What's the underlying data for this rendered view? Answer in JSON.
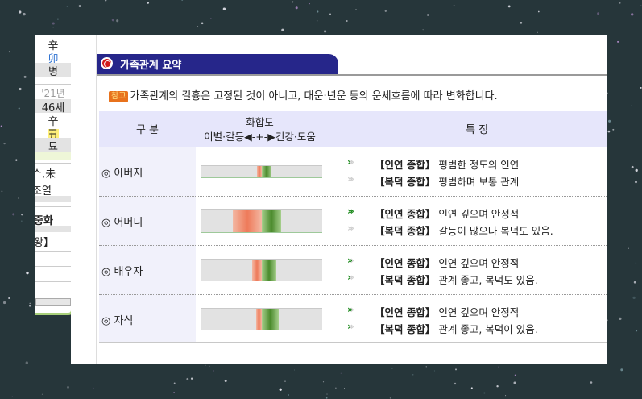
{
  "left_panel": {
    "line1": "辛",
    "line2": "卯",
    "line3": "병",
    "year": "'21년",
    "age": "46세",
    "line6": "辛",
    "line7": "丑",
    "line8": "묘",
    "frag1": "ᄉ,未",
    "frag2": "조열",
    "frag3": "중화",
    "frag4": "왕】"
  },
  "header": {
    "title": "가족관계 요약"
  },
  "note": {
    "badge": "참고",
    "text": "가족관계의 길흉은 고정된 것이 아니고, 대운·년운 등의 운세흐름에 따라 변화합니다."
  },
  "table": {
    "col1": "구 분",
    "col2_line1": "화합도",
    "col2_line2": "이별·갈등◀-+-▶건강·도움",
    "col3": "특 징",
    "rows": [
      {
        "name": "◎ 아버지",
        "bar": {
          "red_from": -0.04,
          "red_to": 0.0,
          "green_to": 0.08
        },
        "f1_chev": 1,
        "f1_label": "【인연 종합】",
        "f1_text": "평범한 정도의 인연",
        "f2_chev": 0,
        "f2_label": "【복덕 종합】",
        "f2_text": "평범하며 보통 관계"
      },
      {
        "name": "◎ 어머니",
        "bar": {
          "red_from": -0.24,
          "red_to": 0.0,
          "green_to": 0.16
        },
        "f1_chev": 3,
        "f1_label": "【인연 종합】",
        "f1_text": "인연 깊으며 안정적",
        "f2_chev": 0,
        "f2_label": "【복덕 종합】",
        "f2_text": "갈등이 많으나 복덕도 있음."
      },
      {
        "name": "◎ 배우자",
        "bar": {
          "red_from": -0.08,
          "red_to": 0.0,
          "green_to": 0.12
        },
        "f1_chev": 2,
        "f1_label": "【인연 종합】",
        "f1_text": "인연 깊으며 안정적",
        "f2_chev": 1,
        "f2_label": "【복덕 종합】",
        "f2_text": "관계 좋고, 복덕도 있음."
      },
      {
        "name": "◎ 자식",
        "bar": {
          "red_from": -0.05,
          "red_to": 0.0,
          "green_to": 0.14
        },
        "f1_chev": 2,
        "f1_label": "【인연 종합】",
        "f1_text": "인연 깊으며 안정적",
        "f2_chev": 1,
        "f2_label": "【복덕 종합】",
        "f2_text": "관계 좋고, 복덕이 있음."
      }
    ]
  }
}
